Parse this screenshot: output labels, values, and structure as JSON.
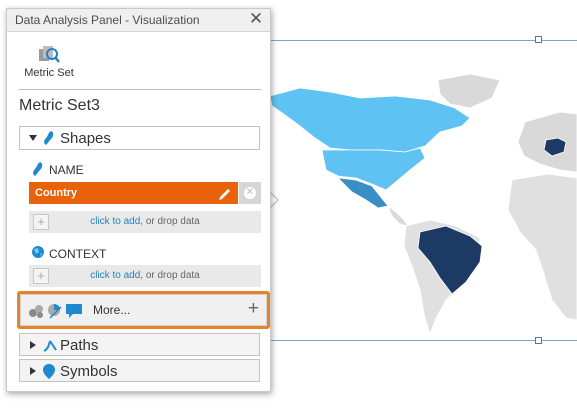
{
  "window": {
    "title": "Data Analysis Panel - Visualization",
    "close_glyph": "✕"
  },
  "toolbar": {
    "metric_set_label": "Metric Set",
    "metric_set_icon": "metric-set-icon"
  },
  "metric_set_name": "Metric Set3",
  "sections": {
    "shapes": {
      "label": "Shapes",
      "expanded": true,
      "icon": "shape-icon"
    },
    "paths": {
      "label": "Paths",
      "expanded": false,
      "icon": "path-icon"
    },
    "symbols": {
      "label": "Symbols",
      "expanded": false,
      "icon": "symbol-pin-icon"
    }
  },
  "fields": {
    "name": {
      "label": "NAME",
      "value": "Country"
    },
    "context": {
      "label": "CONTEXT"
    },
    "dropzone": {
      "link": "click to add",
      "rest": ", or drop data",
      "plus": "+"
    }
  },
  "more": {
    "label": "More...",
    "plus": "+"
  },
  "map": {
    "highlighted_countries": [
      "USA",
      "Mexico",
      "Brazil",
      "Germany"
    ],
    "colors": {
      "land": "#e2e2e2",
      "usa": "#5ec3f2",
      "canada": "#5ec3f2",
      "mexico": "#3a8ec6",
      "brazil": "#1c3a63",
      "germany": "#1c3a63"
    }
  },
  "colors": {
    "accent_orange": "#e8620b",
    "highlight_outline": "#e8832b",
    "link_blue": "#2a7fc0"
  }
}
